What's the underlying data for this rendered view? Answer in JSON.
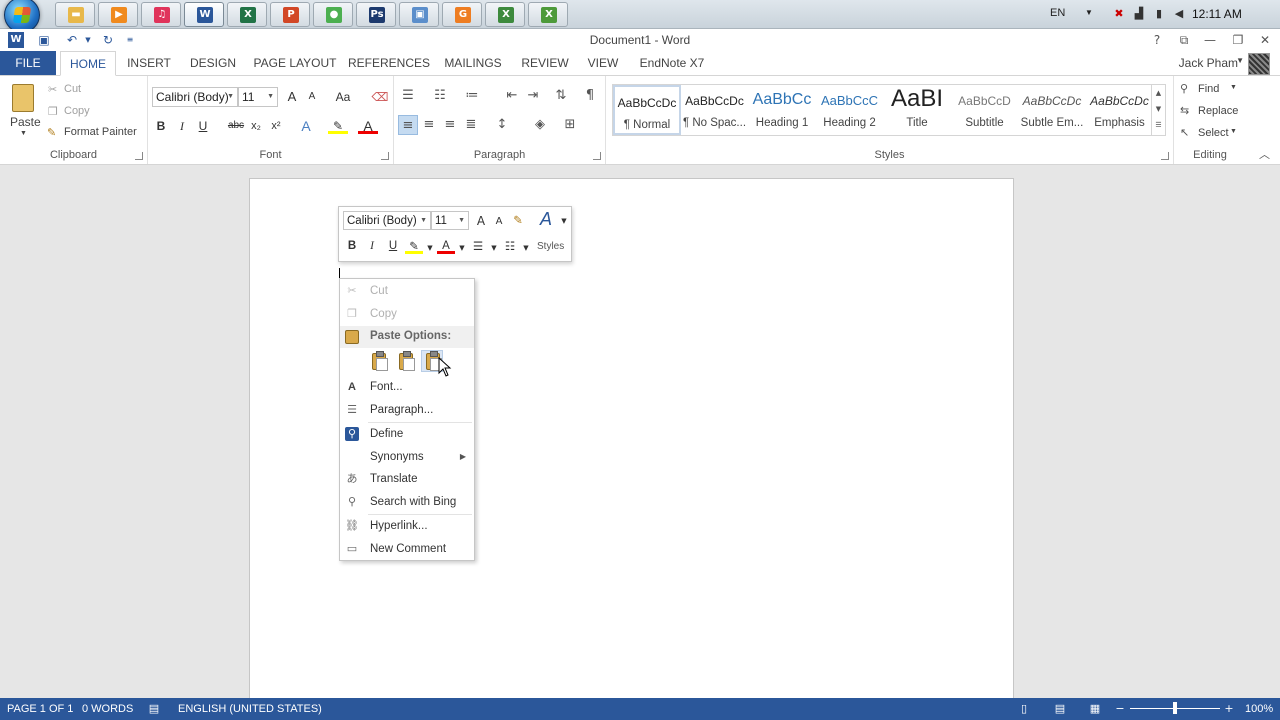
{
  "taskbar": {
    "apps": [
      {
        "name": "explorer",
        "glyph": "▬",
        "color": "#e8b84a"
      },
      {
        "name": "media-player",
        "glyph": "▶",
        "color": "#f08a1e"
      },
      {
        "name": "itunes",
        "glyph": "♫",
        "color": "#e0345b"
      },
      {
        "name": "word",
        "glyph": "W",
        "color": "#2b579a"
      },
      {
        "name": "excel",
        "glyph": "X",
        "color": "#217346"
      },
      {
        "name": "powerpoint",
        "glyph": "P",
        "color": "#d24726"
      },
      {
        "name": "chrome",
        "glyph": "●",
        "color": "#4caf50"
      },
      {
        "name": "photoshop",
        "glyph": "Ps",
        "color": "#1d3a6e"
      },
      {
        "name": "remote-desktop",
        "glyph": "▣",
        "color": "#5b8ecb"
      },
      {
        "name": "app-orange",
        "glyph": "G",
        "color": "#ee7d22"
      },
      {
        "name": "excel-2",
        "glyph": "X",
        "color": "#3d8a3d"
      },
      {
        "name": "excel-3",
        "glyph": "X",
        "color": "#4d9a3a"
      }
    ],
    "lang": "EN",
    "clock": "12:11 AM"
  },
  "title": {
    "doc_title": "Document1 - Word",
    "help": "?"
  },
  "tabs": {
    "file": "FILE",
    "items": [
      "HOME",
      "INSERT",
      "DESIGN",
      "PAGE LAYOUT",
      "REFERENCES",
      "MAILINGS",
      "REVIEW",
      "VIEW",
      "EndNote X7"
    ],
    "user": "Jack Pham"
  },
  "ribbon": {
    "clipboard": {
      "label": "Clipboard",
      "paste": "Paste",
      "cut": "Cut",
      "copy": "Copy",
      "format_painter": "Format Painter"
    },
    "font": {
      "label": "Font",
      "font_name": "Calibri (Body)",
      "font_size": "11",
      "bold": "B",
      "italic": "I",
      "underline": "U",
      "strike": "abc",
      "subscript": "x₂",
      "superscript": "x²",
      "grow": "A",
      "shrink": "A",
      "case": "Aa"
    },
    "paragraph": {
      "label": "Paragraph"
    },
    "styles": {
      "label": "Styles",
      "items": [
        {
          "sample": "AaBbCcDc",
          "name": "¶ Normal",
          "color": "#222"
        },
        {
          "sample": "AaBbCcDc",
          "name": "¶ No Spac...",
          "color": "#222"
        },
        {
          "sample": "AaBbCc",
          "name": "Heading 1",
          "color": "#2e74b5"
        },
        {
          "sample": "AaBbCcC",
          "name": "Heading 2",
          "color": "#2e74b5"
        },
        {
          "sample": "AaBI",
          "name": "Title",
          "color": "#222"
        },
        {
          "sample": "AaBbCcD",
          "name": "Subtitle",
          "color": "#777"
        },
        {
          "sample": "AaBbCcDc",
          "name": "Subtle Em...",
          "color": "#555"
        },
        {
          "sample": "AaBbCcDc",
          "name": "Emphasis",
          "color": "#333"
        }
      ]
    },
    "editing": {
      "label": "Editing",
      "find": "Find",
      "replace": "Replace",
      "select": "Select"
    }
  },
  "minitoolbar": {
    "font_name": "Calibri (Body)",
    "font_size": "11",
    "bold": "B",
    "italic": "I",
    "underline": "U",
    "styles": "Styles"
  },
  "context_menu": {
    "cut": "Cut",
    "copy": "Copy",
    "paste_options": "Paste Options:",
    "font": "Font...",
    "paragraph": "Paragraph...",
    "define": "Define",
    "synonyms": "Synonyms",
    "translate": "Translate",
    "search_bing": "Search with Bing",
    "hyperlink": "Hyperlink...",
    "new_comment": "New Comment"
  },
  "status": {
    "page": "PAGE 1 OF 1",
    "words": "0 WORDS",
    "language": "ENGLISH (UNITED STATES)",
    "zoom": "100%",
    "zoom_fraction": 0.5
  }
}
